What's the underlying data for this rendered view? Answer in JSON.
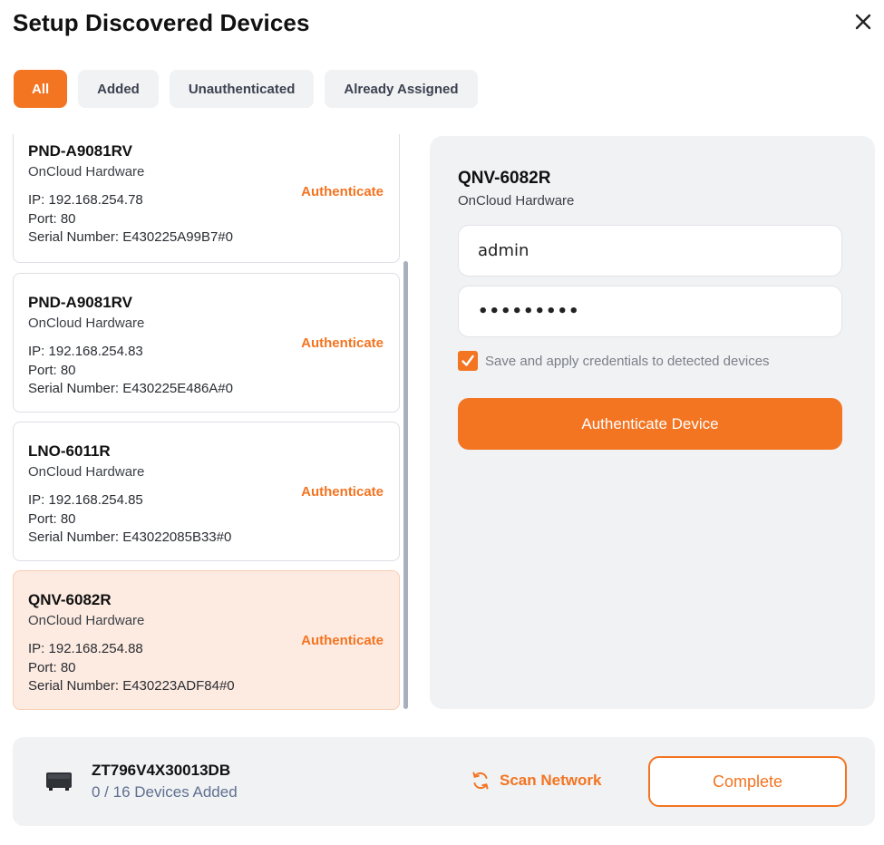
{
  "dialog": {
    "title": "Setup Discovered Devices"
  },
  "tabs": [
    {
      "label": "All",
      "active": true
    },
    {
      "label": "Added",
      "active": false
    },
    {
      "label": "Unauthenticated",
      "active": false
    },
    {
      "label": "Already Assigned",
      "active": false
    }
  ],
  "devices": [
    {
      "name": "PND-A9081RV",
      "vendor": "OnCloud Hardware",
      "ip": "IP: 192.168.254.78",
      "port": "Port: 80",
      "serial": "Serial Number: E430225A99B7#0",
      "action": "Authenticate",
      "selected": false
    },
    {
      "name": "PND-A9081RV",
      "vendor": "OnCloud Hardware",
      "ip": "IP: 192.168.254.83",
      "port": "Port: 80",
      "serial": "Serial Number: E430225E486A#0",
      "action": "Authenticate",
      "selected": false
    },
    {
      "name": "LNO-6011R",
      "vendor": "OnCloud Hardware",
      "ip": "IP: 192.168.254.85",
      "port": "Port: 80",
      "serial": "Serial Number: E43022085B33#0",
      "action": "Authenticate",
      "selected": false
    },
    {
      "name": "QNV-6082R",
      "vendor": "OnCloud Hardware",
      "ip": "IP: 192.168.254.88",
      "port": "Port: 80",
      "serial": "Serial Number: E430223ADF84#0",
      "action": "Authenticate",
      "selected": true
    }
  ],
  "detail": {
    "name": "QNV-6082R",
    "vendor": "OnCloud Hardware",
    "username_value": "admin",
    "password_masked": "•••••••••",
    "save_credentials_label": "Save and apply credentials to detected devices",
    "save_credentials_checked": true,
    "authenticate_button": "Authenticate Device"
  },
  "footer": {
    "gateway_name": "ZT796V4X30013DB",
    "devices_added": "0 / 16 Devices Added",
    "scan_label": "Scan Network",
    "complete_label": "Complete"
  },
  "colors": {
    "accent": "#f37421",
    "selected_card": "#fdebe1",
    "panel": "#f1f2f4"
  },
  "icons": {
    "close": "close-icon",
    "checkbox": "checkmark-icon",
    "gateway": "gateway-device-icon",
    "scan": "refresh-icon"
  }
}
